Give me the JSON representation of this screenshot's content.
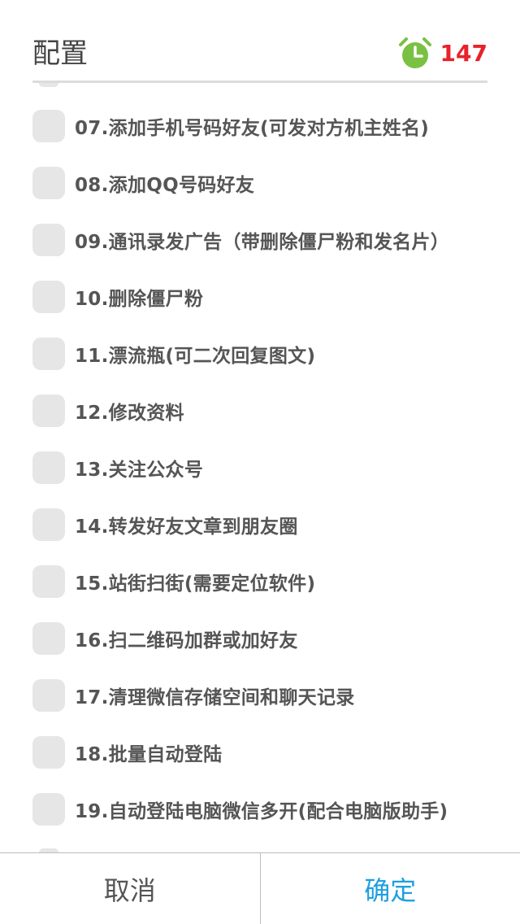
{
  "header": {
    "title": "配置",
    "timer_count": "147",
    "timer_icon": "alarm-clock-icon",
    "timer_color": "#e8222a",
    "icon_color": "#7ac143"
  },
  "items": [
    {
      "label": "07.添加手机号码好友(可发对方机主姓名)",
      "checked": false
    },
    {
      "label": "08.添加QQ号码好友",
      "checked": false
    },
    {
      "label": "09.通讯录发广告（带删除僵尸粉和发名片）",
      "checked": false
    },
    {
      "label": "10.删除僵尸粉",
      "checked": false
    },
    {
      "label": "11.漂流瓶(可二次回复图文)",
      "checked": false
    },
    {
      "label": "12.修改资料",
      "checked": false
    },
    {
      "label": "13.关注公众号",
      "checked": false
    },
    {
      "label": "14.转发好友文章到朋友圈",
      "checked": false
    },
    {
      "label": "15.站街扫街(需要定位软件)",
      "checked": false
    },
    {
      "label": "16.扫二维码加群或加好友",
      "checked": false
    },
    {
      "label": "17.清理微信存储空间和聊天记录",
      "checked": false
    },
    {
      "label": "18.批量自动登陆",
      "checked": false
    },
    {
      "label": "19.自动登陆电脑微信多开(配合电脑版助手)",
      "checked": false
    }
  ],
  "footer": {
    "cancel_label": "取消",
    "ok_label": "确定",
    "ok_color": "#1ea0e0"
  }
}
